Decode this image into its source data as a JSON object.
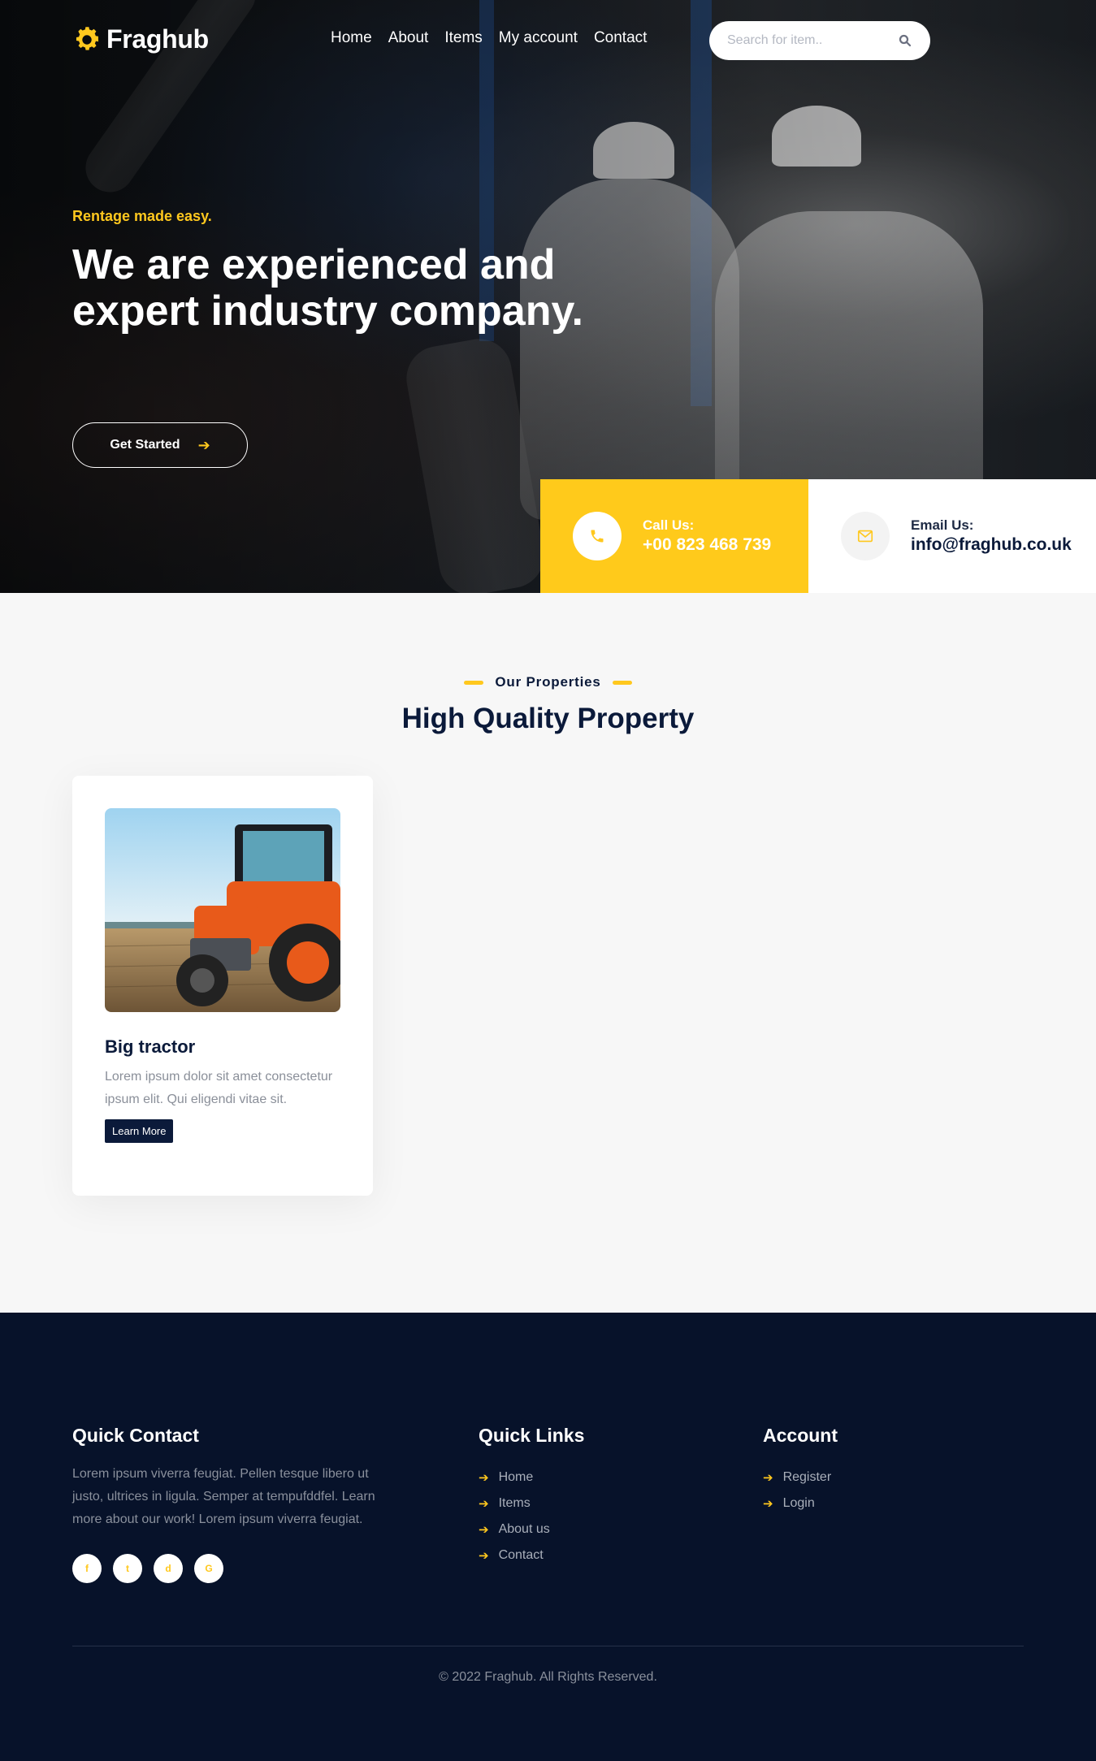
{
  "brand": {
    "name": "Fraghub",
    "accent": "#ffc81e",
    "navy": "#0b1a3a"
  },
  "nav": {
    "items": [
      "Home",
      "About",
      "Items",
      "My account",
      "Contact"
    ],
    "search_placeholder": "Search for item.."
  },
  "hero": {
    "tagline": "Rentage made easy.",
    "headline": "We are experienced and expert industry company.",
    "cta_label": "Get Started"
  },
  "contact": {
    "phone_label": "Call Us:",
    "phone_value": "+00 823 468 739",
    "email_label": "Email Us:",
    "email_value": "info@fraghub.co.uk"
  },
  "properties": {
    "eyebrow": "Our Properties",
    "title": "High Quality Property",
    "cards": [
      {
        "title": "Big tractor",
        "description": "Lorem ipsum dolor sit amet consectetur ipsum elit. Qui eligendi vitae sit.",
        "button": "Learn More"
      }
    ]
  },
  "footer": {
    "contact_title": "Quick Contact",
    "contact_text": "Lorem ipsum viverra feugiat. Pellen tesque libero ut justo, ultrices in ligula. Semper at tempufddfel. Learn more about our work! Lorem ipsum viverra feugiat.",
    "socials": [
      "f",
      "t",
      "d",
      "G"
    ],
    "links_title": "Quick Links",
    "links": [
      "Home",
      "Items",
      "About us",
      "Contact"
    ],
    "account_title": "Account",
    "account_links": [
      "Register",
      "Login"
    ],
    "copyright": "© 2022 Fraghub. All Rights Reserved."
  }
}
